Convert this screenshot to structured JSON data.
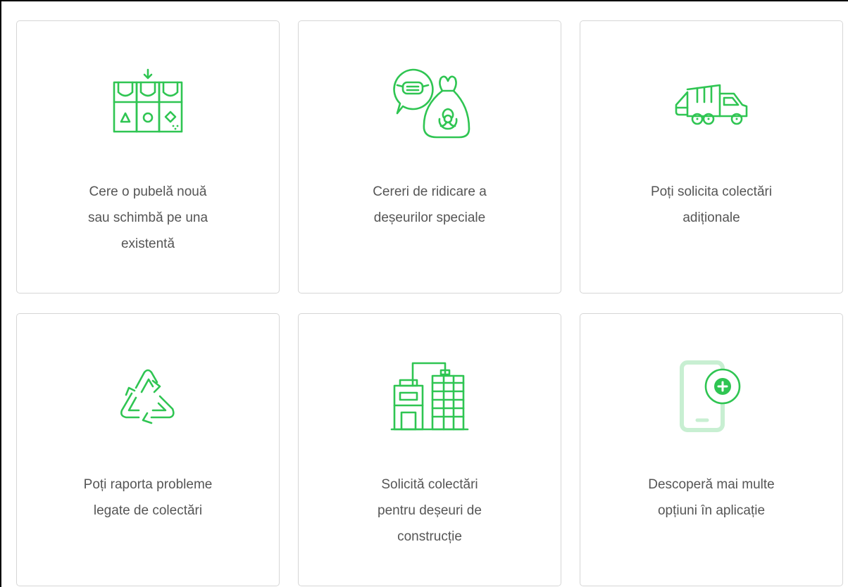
{
  "services": [
    {
      "icon": "bins-icon",
      "label": "Cere o pubelă nouă\nsau schimbă pe una\nexistentă"
    },
    {
      "icon": "biohazard-waste-icon",
      "label": "Cereri de ridicare a\ndeșeurilor speciale"
    },
    {
      "icon": "garbage-truck-icon",
      "label": "Poți solicita colectări\nadiționale"
    },
    {
      "icon": "recycle-icon",
      "label": "Poți raporta probleme\nlegate de colectări"
    },
    {
      "icon": "construction-building-icon",
      "label": "Solicită colectări\npentru deșeuri de\nconstrucție"
    },
    {
      "icon": "phone-plus-icon",
      "label": "Descoperă mai multe\nopțiuni în aplicație"
    }
  ],
  "colors": {
    "accent": "#2fc552",
    "accent_light": "#c8efd2",
    "text": "#555555",
    "card_border": "#d6d6d6"
  }
}
